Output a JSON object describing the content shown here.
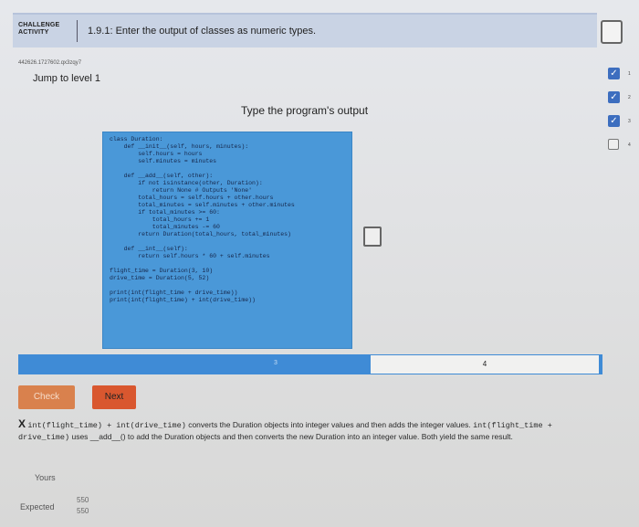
{
  "header": {
    "badge_line1": "CHALLENGE",
    "badge_line2": "ACTIVITY",
    "title": "1.9.1: Enter the output of classes as numeric types."
  },
  "user_id": "442626.1727602.qx3zqy7",
  "jump_link": "Jump to level 1",
  "prompt": "Type the program's output",
  "code_lines": [
    "class Duration:",
    "    def __init__(self, hours, minutes):",
    "        self.hours = hours",
    "        self.minutes = minutes",
    "",
    "    def __add__(self, other):",
    "        if not isinstance(other, Duration):",
    "            return None # Outputs 'None'",
    "        total_hours = self.hours + other.hours",
    "        total_minutes = self.minutes + other.minutes",
    "        if total_minutes >= 60:",
    "            total_hours += 1",
    "            total_minutes -= 60",
    "        return Duration(total_hours, total_minutes)",
    "",
    "    def __int__(self):",
    "        return self.hours * 60 + self.minutes",
    "",
    "flight_time = Duration(3, 10)",
    "drive_time = Duration(5, 52)",
    "",
    "print(int(flight_time + drive_time))",
    "print(int(flight_time) + int(drive_time))"
  ],
  "sidebar_levels": [
    {
      "num": "1",
      "status": "done"
    },
    {
      "num": "2",
      "status": "done"
    },
    {
      "num": "3",
      "status": "done"
    },
    {
      "num": "4",
      "status": "empty"
    }
  ],
  "level_bar": {
    "mark": "3",
    "current": "4"
  },
  "buttons": {
    "check": "Check",
    "next": "Next"
  },
  "explanation": {
    "mark": "X",
    "code1": "int(flight_time) + int(drive_time)",
    "text1": " converts the Duration objects into integer values and then adds the integer values.",
    "code2": "int(flight_time + drive_time)",
    "text2": " uses __add__() to add the Duration objects and then converts the new Duration into an integer value. Both yield the same result."
  },
  "results": {
    "yours_label": "Yours",
    "expected_label": "Expected",
    "expected_values": [
      "550",
      "550"
    ]
  },
  "colors": {
    "accent_blue": "#3f8bd6",
    "code_bg": "#4a98d8",
    "check_btn": "#d9814d",
    "next_btn": "#d9572f"
  }
}
